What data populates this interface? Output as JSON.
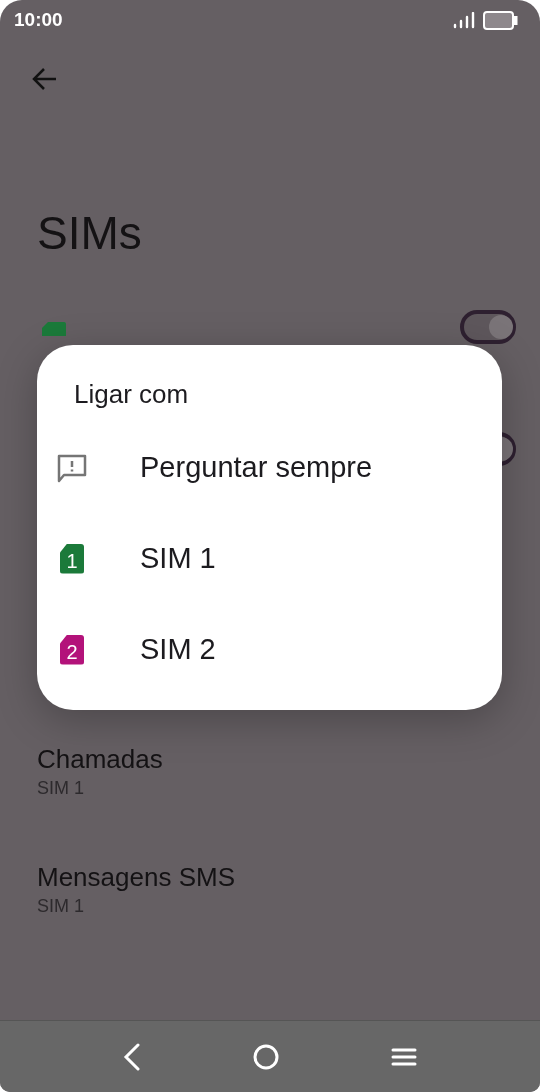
{
  "status_bar": {
    "time": "10:00"
  },
  "page": {
    "title": "SIMs"
  },
  "sim_rows": [
    {
      "color": "#1b7a3a",
      "on": true
    },
    {
      "on": true
    }
  ],
  "settings": [
    {
      "label": "Chamadas",
      "value": "SIM 1"
    },
    {
      "label": "Mensagens SMS",
      "value": "SIM 1"
    }
  ],
  "dialog": {
    "title": "Ligar com",
    "options": [
      {
        "kind": "ask",
        "label": "Perguntar sempre"
      },
      {
        "kind": "sim",
        "label": "SIM 1",
        "number": "1",
        "color": "#1b7a3a"
      },
      {
        "kind": "sim",
        "label": "SIM 2",
        "number": "2",
        "color": "#b3127a"
      }
    ]
  }
}
